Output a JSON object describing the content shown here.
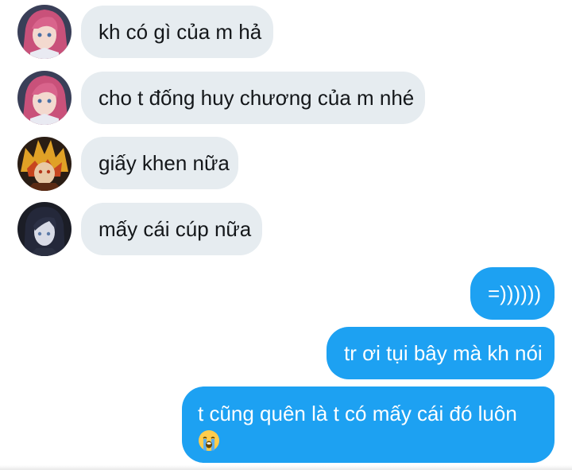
{
  "conversation": {
    "messages": [
      {
        "sender": "them",
        "avatar": "pink-hair-character-avatar",
        "text": "kh có gì của m hả"
      },
      {
        "sender": "them",
        "avatar": "pink-hair-character-avatar",
        "text": "cho t đống huy chương của m nhé"
      },
      {
        "sender": "them",
        "avatar": "flame-hair-character-avatar",
        "text": "giấy khen nữa"
      },
      {
        "sender": "them",
        "avatar": "dark-hair-character-avatar",
        "text": "mấy cái cúp nữa"
      },
      {
        "sender": "me",
        "text": "=))))))"
      },
      {
        "sender": "me",
        "text": "tr ơi tụi bây mà kh nói"
      },
      {
        "sender": "me",
        "text": "t cũng quên là t có mấy cái đó luôn",
        "emoji": "loudly-crying-face-icon"
      }
    ]
  },
  "colors": {
    "received_bubble": "#e6ecf0",
    "sent_bubble": "#1da1f2",
    "received_text": "#14171a",
    "sent_text": "#ffffff"
  }
}
